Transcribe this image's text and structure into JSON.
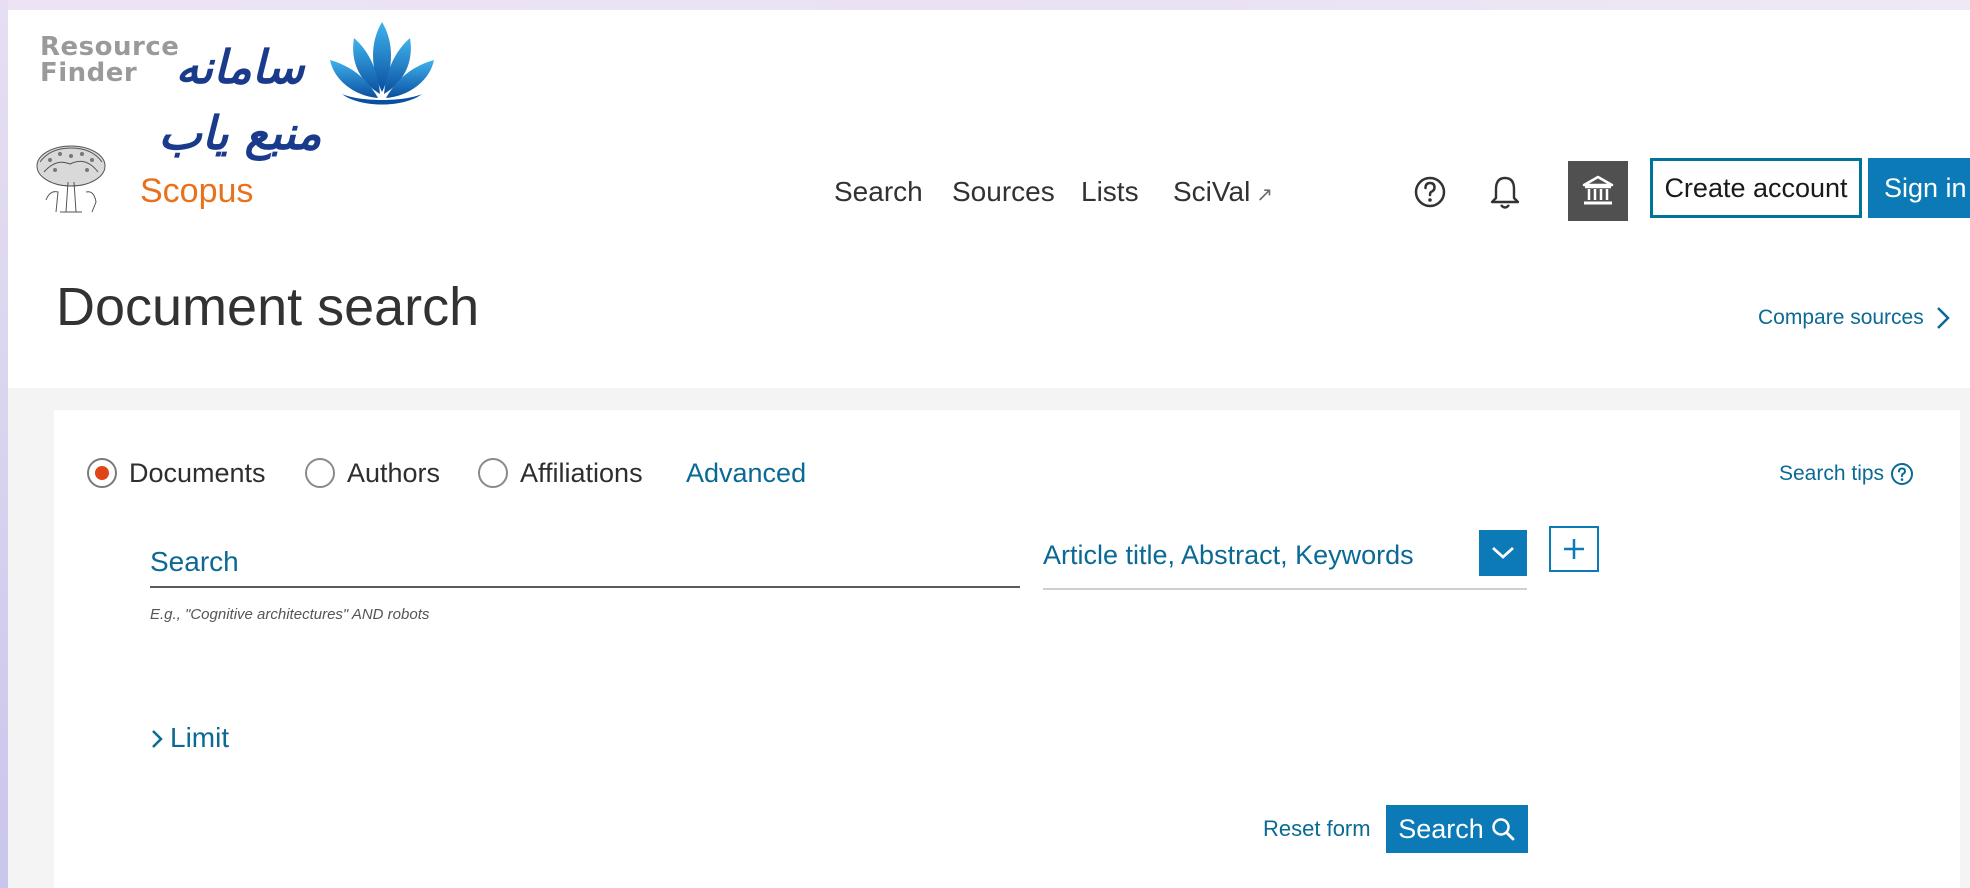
{
  "brand": {
    "rf_en_line1": "Resource",
    "rf_en_line2": "Finder",
    "rf_fa": "سامانه منبع یاب",
    "scopus_name": "Scopus"
  },
  "nav": {
    "items": [
      {
        "label": "Search"
      },
      {
        "label": "Sources"
      },
      {
        "label": "Lists"
      },
      {
        "label": "SciVal",
        "ext": "↗"
      }
    ]
  },
  "header": {
    "create_account": "Create account",
    "sign_in": "Sign in"
  },
  "page": {
    "title": "Document search",
    "compare_sources": "Compare sources"
  },
  "search_form": {
    "types": [
      {
        "label": "Documents",
        "checked": true
      },
      {
        "label": "Authors",
        "checked": false
      },
      {
        "label": "Affiliations",
        "checked": false
      }
    ],
    "advanced": "Advanced",
    "search_tips": "Search tips",
    "search_placeholder": "Search",
    "field_value": "Article title, Abstract, Keywords",
    "hint": "E.g., \"Cognitive architectures\" AND robots",
    "limit": "Limit",
    "reset": "Reset form",
    "submit": "Search"
  },
  "colors": {
    "accent": "#0b7ab6",
    "link": "#0a6a95",
    "scopus_orange": "#e9711c",
    "radio_selected": "#e0451a"
  },
  "icons": [
    "help-icon",
    "bell-icon",
    "institution-icon",
    "chevron-right-icon",
    "chevron-down-icon",
    "plus-icon",
    "search-icon"
  ]
}
